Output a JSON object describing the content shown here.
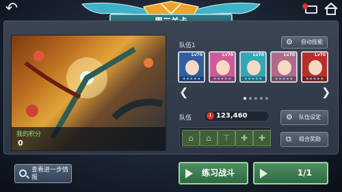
{
  "header": {
    "title": "周二关卡"
  },
  "battle_art": {
    "score_label": "我的积分",
    "score_value": "0"
  },
  "team": {
    "label": "队伍1",
    "auto_skill_label": "自动技能",
    "heroes": [
      {
        "level": "Lv70",
        "stars": "★★★★★",
        "color": "#2f5fa0"
      },
      {
        "level": "Lv70",
        "stars": "★★★★★",
        "color": "#d05a9a"
      },
      {
        "level": "Lv70",
        "stars": "★★★★★",
        "color": "#33a6b8"
      },
      {
        "level": "Lv70",
        "stars": "★★★★★",
        "color": "#b06b8a"
      },
      {
        "level": "Lv70",
        "stars": "★★★★★",
        "color": "#b82f2a"
      }
    ],
    "page_count": 5,
    "active_page": 1
  },
  "squad": {
    "label": "队伍",
    "power_value": "123,460",
    "formation_slots": [
      "⌂",
      "⌂",
      "⊤",
      "✚",
      "✚"
    ],
    "settings_label": "队伍设定",
    "combo_reward_label": "组合奖励"
  },
  "footer": {
    "more_info_label": "查看进一步情报",
    "practice_label": "练习战斗",
    "fight_count": "1/1"
  },
  "colors": {
    "accent_green": "#4d8f5f",
    "title_teal": "#2e7c89",
    "power_red": "#d8342c"
  }
}
